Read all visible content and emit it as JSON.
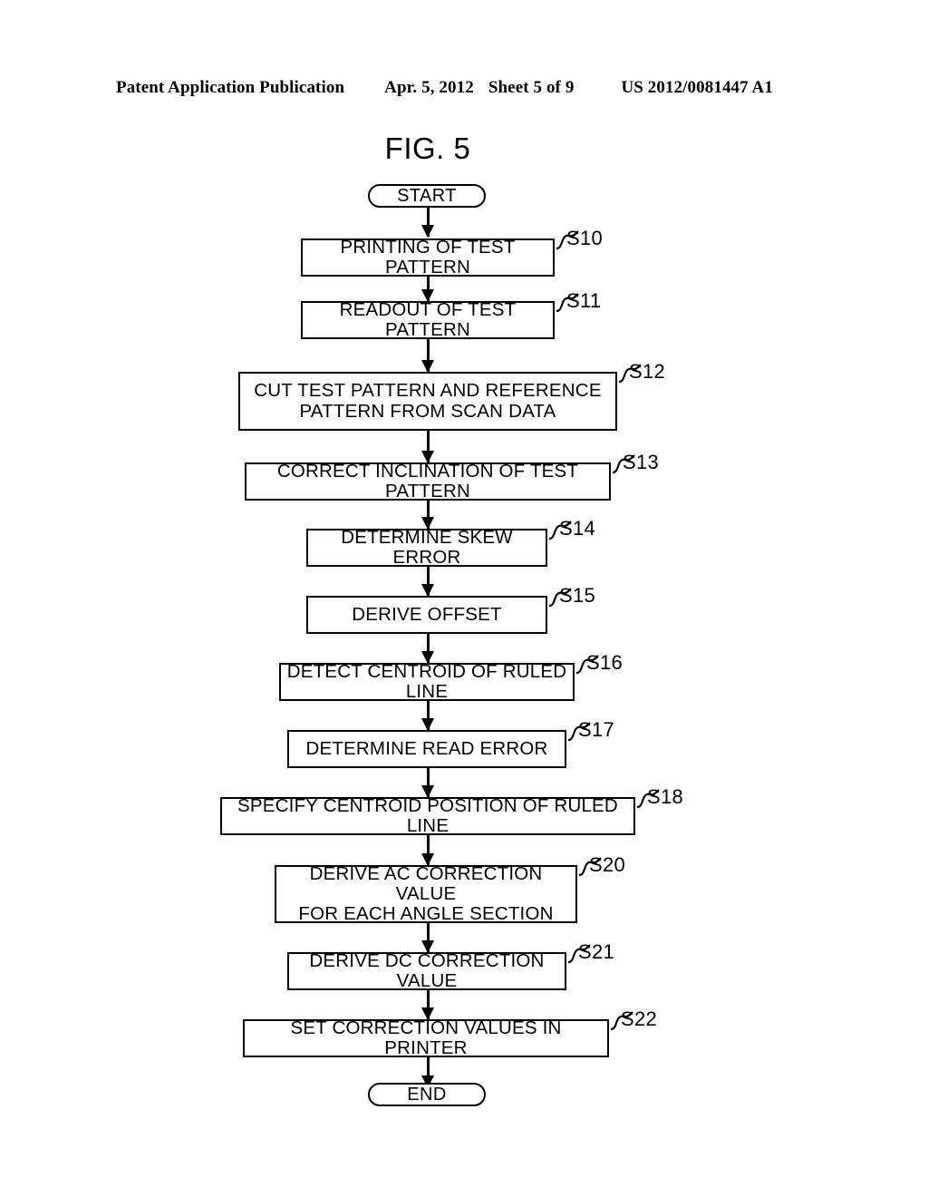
{
  "header": {
    "publication": "Patent Application Publication",
    "date": "Apr. 5, 2012",
    "sheet": "Sheet 5 of 9",
    "number": "US 2012/0081447 A1"
  },
  "figure": {
    "title": "FIG. 5"
  },
  "chart_data": {
    "type": "diagram",
    "diagram_type": "flowchart",
    "title": "FIG. 5",
    "orientation": "top-to-bottom",
    "nodes": [
      {
        "id": "start",
        "shape": "terminal",
        "label": "START",
        "step": ""
      },
      {
        "id": "s10",
        "shape": "process",
        "label": "PRINTING OF TEST PATTERN",
        "step": "S10"
      },
      {
        "id": "s11",
        "shape": "process",
        "label": "READOUT OF TEST PATTERN",
        "step": "S11"
      },
      {
        "id": "s12",
        "shape": "process",
        "label": "CUT TEST PATTERN AND REFERENCE\nPATTERN FROM SCAN DATA",
        "step": "S12"
      },
      {
        "id": "s13",
        "shape": "process",
        "label": "CORRECT INCLINATION OF TEST PATTERN",
        "step": "S13"
      },
      {
        "id": "s14",
        "shape": "process",
        "label": "DETERMINE SKEW ERROR",
        "step": "S14"
      },
      {
        "id": "s15",
        "shape": "process",
        "label": "DERIVE OFFSET",
        "step": "S15"
      },
      {
        "id": "s16",
        "shape": "process",
        "label": "DETECT CENTROID OF RULED LINE",
        "step": "S16"
      },
      {
        "id": "s17",
        "shape": "process",
        "label": "DETERMINE READ ERROR",
        "step": "S17"
      },
      {
        "id": "s18",
        "shape": "process",
        "label": "SPECIFY CENTROID POSITION OF RULED LINE",
        "step": "S18"
      },
      {
        "id": "s20",
        "shape": "process",
        "label": "DERIVE AC CORRECTION VALUE\nFOR EACH ANGLE SECTION",
        "step": "S20"
      },
      {
        "id": "s21",
        "shape": "process",
        "label": "DERIVE DC CORRECTION VALUE",
        "step": "S21"
      },
      {
        "id": "s22",
        "shape": "process",
        "label": "SET CORRECTION VALUES IN PRINTER",
        "step": "S22"
      },
      {
        "id": "end",
        "shape": "terminal",
        "label": "END",
        "step": ""
      }
    ],
    "edges": [
      {
        "from": "start",
        "to": "s10"
      },
      {
        "from": "s10",
        "to": "s11"
      },
      {
        "from": "s11",
        "to": "s12"
      },
      {
        "from": "s12",
        "to": "s13"
      },
      {
        "from": "s13",
        "to": "s14"
      },
      {
        "from": "s14",
        "to": "s15"
      },
      {
        "from": "s15",
        "to": "s16"
      },
      {
        "from": "s16",
        "to": "s17"
      },
      {
        "from": "s17",
        "to": "s18"
      },
      {
        "from": "s18",
        "to": "s20"
      },
      {
        "from": "s20",
        "to": "s21"
      },
      {
        "from": "s21",
        "to": "s22"
      },
      {
        "from": "s22",
        "to": "end"
      }
    ],
    "colors": {
      "stroke": "#000000",
      "fill": "#ffffff",
      "background": "#ffffff"
    }
  }
}
